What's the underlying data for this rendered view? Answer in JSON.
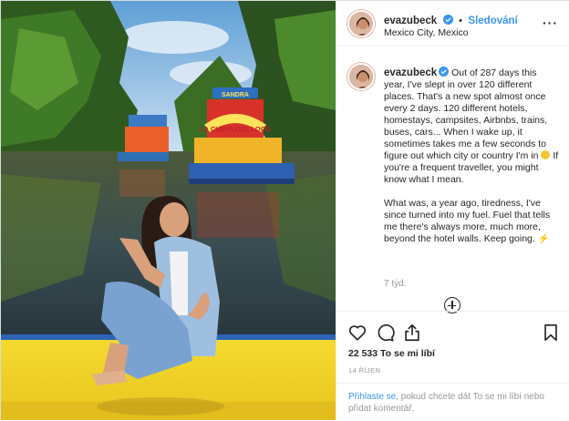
{
  "post": {
    "username": "evazubeck",
    "follow_label": "Sledování",
    "location": "Mexico City, Mexico",
    "caption_p1_a": "Out of 287 days this year, I've slept in over 120 different places. That's a new spot almost once every 2 days. 120 different hotels, homestays, campsites, Airbnbs, trains, buses, cars... When I wake up, it sometimes takes me a few seconds to figure out which city or country I'm in ",
    "caption_p1_b": " If you're a frequent traveller, you might know what I mean.",
    "caption_p2": "What was, a year ago, tiredness, I've since turned into my fuel. Fuel that tells me there's always more, much more, beyond the hotel walls. Keep going. ",
    "bolt_glyph": "⚡",
    "time_ago": "7 týd.",
    "likes": "22 533 To se mi líbí",
    "date": "14 ŘÍJEN",
    "login_link": "Přihlaste se",
    "login_rest": ", pokud chcete dát To se mi líbí nebo přidat komentář."
  },
  "photo": {
    "boat_sign_left": "SANDRA",
    "boat_sign_main": "LA CUEVA DEL LOCO"
  },
  "icons": {
    "more": "more-options-icon",
    "like": "heart-icon",
    "comment": "comment-icon",
    "share": "share-icon",
    "save": "bookmark-icon",
    "verified": "verified-badge-icon",
    "load_more": "plus-circle-icon"
  },
  "colors": {
    "link": "#3897f0",
    "verified": "#3897f0",
    "boat_yellow": "#f2d227"
  }
}
